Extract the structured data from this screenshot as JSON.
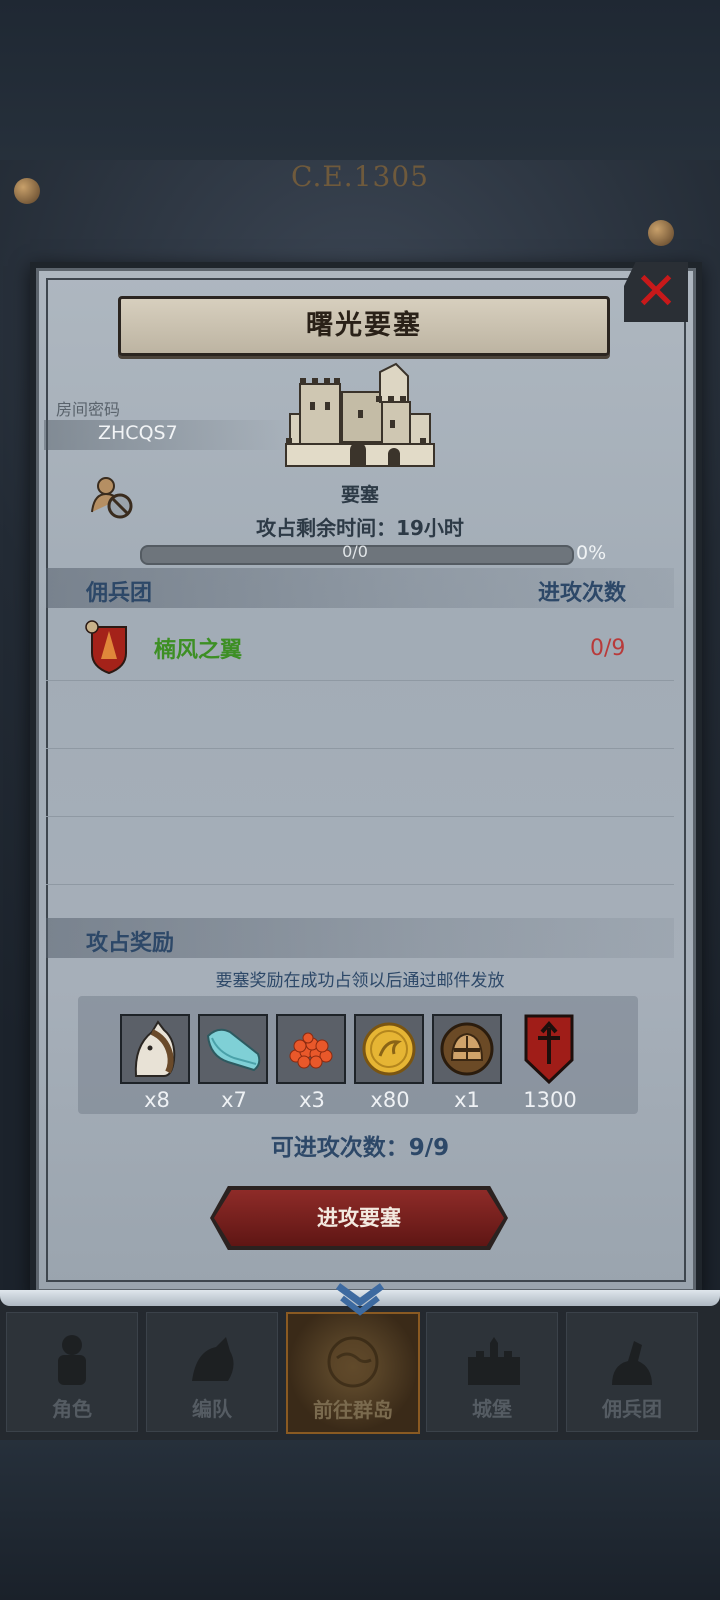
{
  "background": {
    "era": "C.E.1305"
  },
  "modal": {
    "title": "曙光要塞",
    "room": {
      "label": "房间密码",
      "code": "ZHCQS7"
    },
    "fortress_label": "要塞",
    "time_remaining": "攻占剩余时间：19小时",
    "progress": {
      "text": "0/0",
      "percent_label": "0%",
      "value": 0
    },
    "mercenary": {
      "header_left": "佣兵团",
      "header_right": "进攻次数",
      "rows": [
        {
          "name": "楠风之翼",
          "count": "0/9"
        }
      ]
    },
    "rewards": {
      "header": "攻占奖励",
      "note": "要塞奖励在成功占领以后通过邮件发放",
      "items": [
        {
          "icon": "horse-icon",
          "count": "x8"
        },
        {
          "icon": "cloth-icon",
          "count": "x7"
        },
        {
          "icon": "berries-icon",
          "count": "x3"
        },
        {
          "icon": "gold-coin-icon",
          "count": "x80"
        },
        {
          "icon": "knight-helmet-icon",
          "count": "x1"
        },
        {
          "icon": "banner-icon",
          "count": "1300"
        }
      ]
    },
    "attempts": "可进攻次数：9/9",
    "attack_button": "进攻要塞"
  },
  "bottom_nav": [
    {
      "label": "角色",
      "icon": "knight-icon",
      "active": false
    },
    {
      "label": "编队",
      "icon": "formation-icon",
      "active": false
    },
    {
      "label": "前往群岛",
      "icon": "globe-icon",
      "active": true
    },
    {
      "label": "城堡",
      "icon": "castle-icon",
      "active": false
    },
    {
      "label": "佣兵团",
      "icon": "mercenary-icon",
      "active": false
    }
  ],
  "colors": {
    "accent_red": "#b83a3a",
    "merc_green": "#3d8f24",
    "title_blue": "#2d4868"
  }
}
